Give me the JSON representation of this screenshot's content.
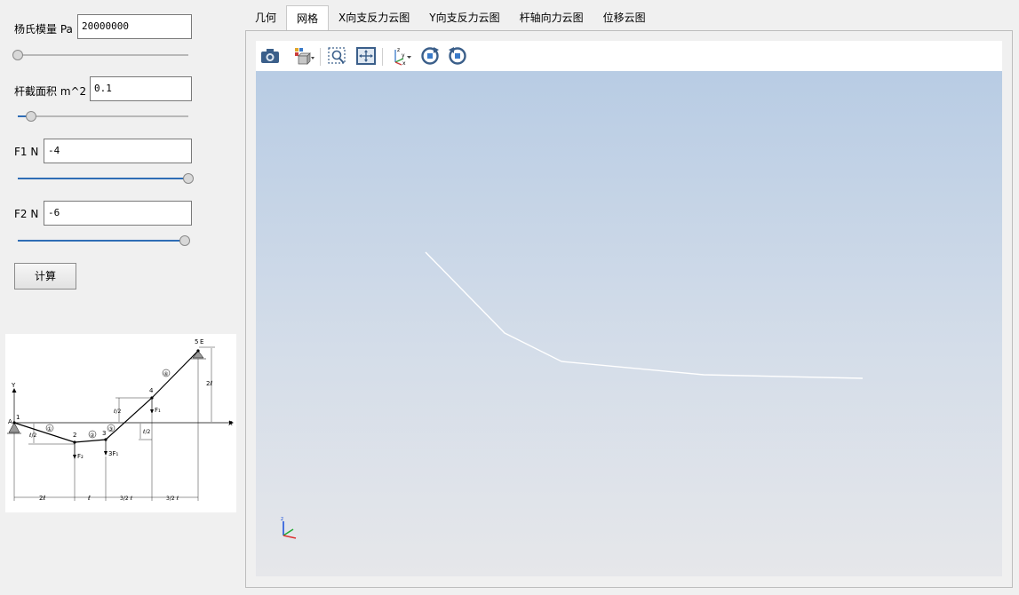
{
  "params": {
    "youngs_modulus": {
      "label": "杨氏模量 Pa",
      "value": "20000000",
      "slider_position": 0.0
    },
    "area": {
      "label": "杆截面积 m^2",
      "value": "0.1",
      "slider_position": 0.08
    },
    "f1": {
      "label": "F1 N",
      "value": "-4",
      "slider_position": 1.0
    },
    "f2": {
      "label": "F2 N",
      "value": "-6",
      "slider_position": 0.98
    }
  },
  "calc_button": "计算",
  "tabs": [
    {
      "label": "几何",
      "active": false
    },
    {
      "label": "网格",
      "active": true
    },
    {
      "label": "X向支反力云图",
      "active": false
    },
    {
      "label": "Y向支反力云图",
      "active": false
    },
    {
      "label": "杆轴向力云图",
      "active": false
    },
    {
      "label": "位移云图",
      "active": false
    }
  ],
  "toolbar_icons": [
    "camera-icon",
    "view-cube-icon",
    "zoom-box-icon",
    "fit-all-icon",
    "axes-orientation-icon",
    "rotate-cw-icon",
    "rotate-ccw-icon"
  ],
  "diagram": {
    "nodes": [
      "1",
      "2",
      "3",
      "4",
      "5"
    ],
    "node_letters": [
      "A",
      "E"
    ],
    "elements": [
      "①",
      "②",
      "③",
      "④"
    ],
    "axis_x": "X",
    "axis_y": "Y",
    "loads": [
      "F₂",
      "3F₁",
      "F₁"
    ],
    "dims_bottom": [
      "2ℓ",
      "ℓ",
      "3/2 ℓ",
      "3/2 ℓ"
    ],
    "dims_side": [
      "ℓ/2",
      "ℓ/2",
      "ℓ/2",
      "2ℓ"
    ]
  },
  "colors": {
    "accent": "#2f6db5",
    "viewport_top": "#b8cce4",
    "viewport_bottom": "#e6e7ea",
    "mesh_line": "#ffffff"
  }
}
